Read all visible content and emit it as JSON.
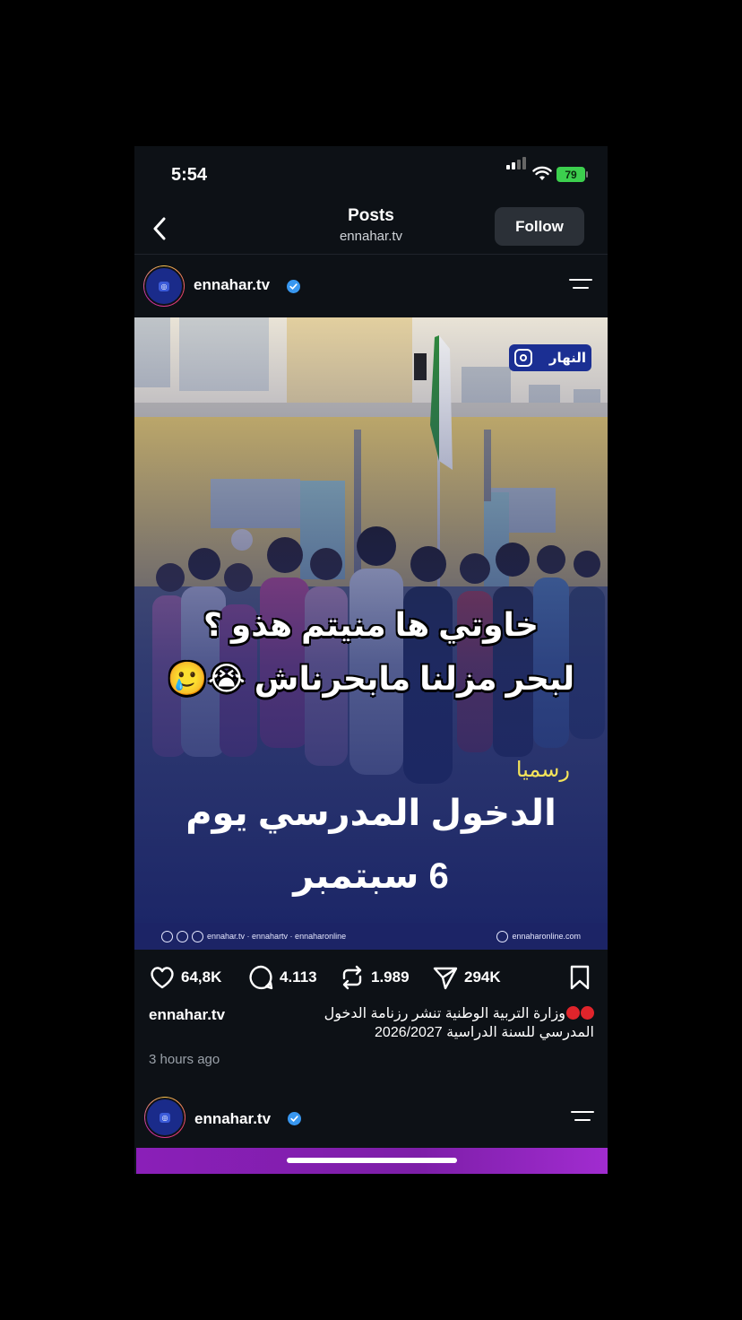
{
  "status_bar": {
    "time": "5:54",
    "battery": "79"
  },
  "header": {
    "title": "Posts",
    "subtitle": "ennahar.tv",
    "follow_label": "Follow"
  },
  "post": {
    "username": "ennahar.tv",
    "image": {
      "watermark": "النهار",
      "overlay_line1": "خاوتي ها منيتم هذو ؟",
      "overlay_line2": "لبحر مزلنا مابحرناش 😭🥲",
      "kicker": "رسميا",
      "headline_line1": "الدخول المدرسي يوم",
      "headline_line2": "6 سبتمبر",
      "footer_social": "ennahar.tv · ennahartv · ennaharonline",
      "footer_site": "ennaharonline.com"
    },
    "likes": "64,8K",
    "comments": "4.113",
    "reposts": "1.989",
    "shares": "294K",
    "caption_user": "ennahar.tv",
    "caption_text": "وزارة التربية الوطنية تنشر رزنامة الدخول المدرسي للسنة الدراسية 2026/2027",
    "time_ago": "3 hours ago"
  },
  "next_post": {
    "username": "ennahar.tv"
  },
  "colors": {
    "background": "#0d1116",
    "verified": "#3897f0",
    "headline_banner": "#1c2466",
    "kicker": "#f4e35a",
    "next_post_banner": "#8a1fb8"
  }
}
